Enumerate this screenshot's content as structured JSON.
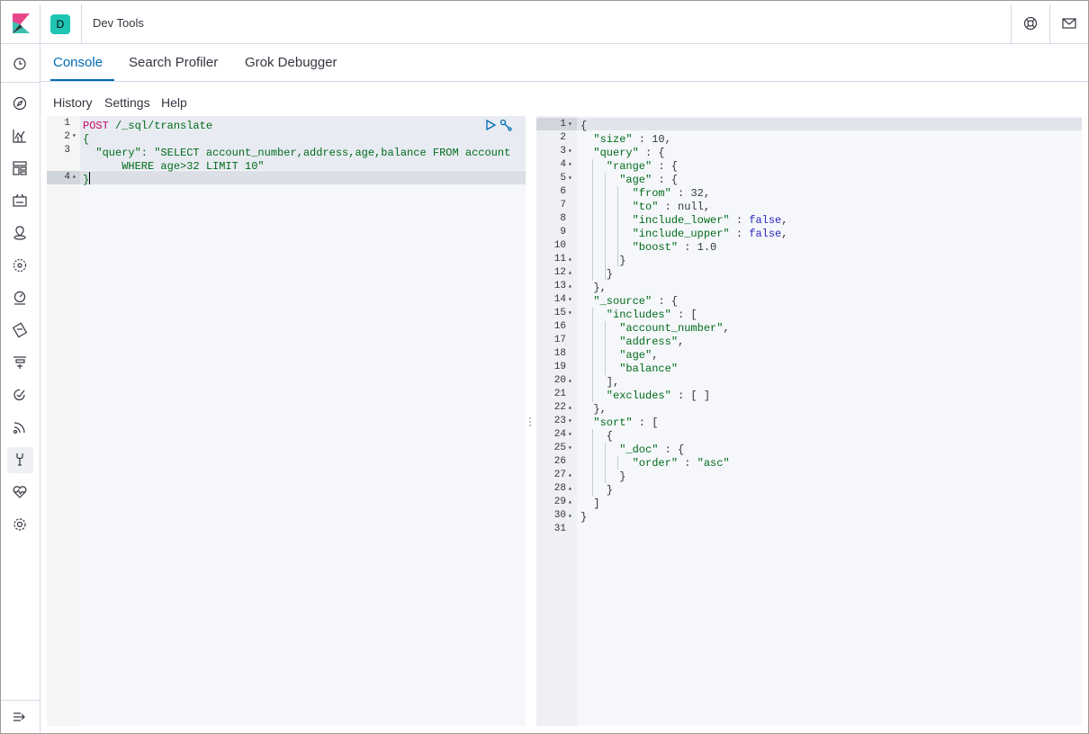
{
  "app": {
    "space_initial": "D",
    "title": "Dev Tools"
  },
  "tabs": [
    {
      "label": "Console",
      "active": true
    },
    {
      "label": "Search Profiler",
      "active": false
    },
    {
      "label": "Grok Debugger",
      "active": false
    }
  ],
  "menu": [
    "History",
    "Settings",
    "Help"
  ],
  "sidebar_icons": [
    "clock-icon",
    "compass-icon",
    "visualize-icon",
    "dashboard-icon",
    "canvas-icon",
    "maps-icon",
    "ml-icon",
    "metrics-icon",
    "logs-icon",
    "apm-icon",
    "uptime-icon",
    "siem-icon",
    "dev-tools-icon",
    "monitoring-icon",
    "management-icon",
    "collapse-icon"
  ],
  "colors": {
    "accent": "#006bb4",
    "space": "#1ec5b3",
    "keyword": "#c80a68",
    "string": "#006b1b",
    "literal": "#2927c2"
  },
  "request_editor": {
    "line_numbers": [
      "1",
      "2",
      "3",
      "",
      "4"
    ],
    "lines": [
      [
        {
          "t": "POST ",
          "c": "kw"
        },
        {
          "t": "/_sql/translate",
          "c": "str"
        }
      ],
      [
        {
          "t": "{",
          "c": "str"
        }
      ],
      [
        {
          "t": "  \"query\": \"SELECT account_number,address,age,balance FROM account",
          "c": "str"
        }
      ],
      [
        {
          "t": "      WHERE age>32 LIMIT 10\"",
          "c": "str"
        }
      ],
      [
        {
          "t": "}",
          "c": "str"
        }
      ]
    ]
  },
  "response_editor": {
    "lines": [
      {
        "n": "1",
        "fold": "▾",
        "seg": [
          {
            "t": "{",
            "c": "p"
          }
        ]
      },
      {
        "n": "2",
        "fold": "",
        "seg": [
          {
            "t": "  \"size\"",
            "c": "str"
          },
          {
            "t": " : ",
            "c": "p"
          },
          {
            "t": "10",
            "c": "num"
          },
          {
            "t": ",",
            "c": "p"
          }
        ]
      },
      {
        "n": "3",
        "fold": "▾",
        "seg": [
          {
            "t": "  \"query\"",
            "c": "str"
          },
          {
            "t": " : {",
            "c": "p"
          }
        ]
      },
      {
        "n": "4",
        "fold": "▾",
        "seg": [
          {
            "t": "    \"range\"",
            "c": "str"
          },
          {
            "t": " : {",
            "c": "p"
          }
        ]
      },
      {
        "n": "5",
        "fold": "▾",
        "seg": [
          {
            "t": "      \"age\"",
            "c": "str"
          },
          {
            "t": " : {",
            "c": "p"
          }
        ]
      },
      {
        "n": "6",
        "fold": "",
        "seg": [
          {
            "t": "        \"from\"",
            "c": "str"
          },
          {
            "t": " : ",
            "c": "p"
          },
          {
            "t": "32",
            "c": "num"
          },
          {
            "t": ",",
            "c": "p"
          }
        ]
      },
      {
        "n": "7",
        "fold": "",
        "seg": [
          {
            "t": "        \"to\"",
            "c": "str"
          },
          {
            "t": " : ",
            "c": "p"
          },
          {
            "t": "null",
            "c": "num"
          },
          {
            "t": ",",
            "c": "p"
          }
        ]
      },
      {
        "n": "8",
        "fold": "",
        "seg": [
          {
            "t": "        \"include_lower\"",
            "c": "str"
          },
          {
            "t": " : ",
            "c": "p"
          },
          {
            "t": "false",
            "c": "lit"
          },
          {
            "t": ",",
            "c": "p"
          }
        ]
      },
      {
        "n": "9",
        "fold": "",
        "seg": [
          {
            "t": "        \"include_upper\"",
            "c": "str"
          },
          {
            "t": " : ",
            "c": "p"
          },
          {
            "t": "false",
            "c": "lit"
          },
          {
            "t": ",",
            "c": "p"
          }
        ]
      },
      {
        "n": "10",
        "fold": "",
        "seg": [
          {
            "t": "        \"boost\"",
            "c": "str"
          },
          {
            "t": " : ",
            "c": "p"
          },
          {
            "t": "1.0",
            "c": "num"
          }
        ]
      },
      {
        "n": "11",
        "fold": "▴",
        "seg": [
          {
            "t": "      }",
            "c": "p"
          }
        ]
      },
      {
        "n": "12",
        "fold": "▴",
        "seg": [
          {
            "t": "    }",
            "c": "p"
          }
        ]
      },
      {
        "n": "13",
        "fold": "▴",
        "seg": [
          {
            "t": "  },",
            "c": "p"
          }
        ]
      },
      {
        "n": "14",
        "fold": "▾",
        "seg": [
          {
            "t": "  \"_source\"",
            "c": "str"
          },
          {
            "t": " : {",
            "c": "p"
          }
        ]
      },
      {
        "n": "15",
        "fold": "▾",
        "seg": [
          {
            "t": "    \"includes\"",
            "c": "str"
          },
          {
            "t": " : [",
            "c": "p"
          }
        ]
      },
      {
        "n": "16",
        "fold": "",
        "seg": [
          {
            "t": "      \"account_number\"",
            "c": "str"
          },
          {
            "t": ",",
            "c": "p"
          }
        ]
      },
      {
        "n": "17",
        "fold": "",
        "seg": [
          {
            "t": "      \"address\"",
            "c": "str"
          },
          {
            "t": ",",
            "c": "p"
          }
        ]
      },
      {
        "n": "18",
        "fold": "",
        "seg": [
          {
            "t": "      \"age\"",
            "c": "str"
          },
          {
            "t": ",",
            "c": "p"
          }
        ]
      },
      {
        "n": "19",
        "fold": "",
        "seg": [
          {
            "t": "      \"balance\"",
            "c": "str"
          }
        ]
      },
      {
        "n": "20",
        "fold": "▴",
        "seg": [
          {
            "t": "    ],",
            "c": "p"
          }
        ]
      },
      {
        "n": "21",
        "fold": "",
        "seg": [
          {
            "t": "    \"excludes\"",
            "c": "str"
          },
          {
            "t": " : [ ]",
            "c": "p"
          }
        ]
      },
      {
        "n": "22",
        "fold": "▴",
        "seg": [
          {
            "t": "  },",
            "c": "p"
          }
        ]
      },
      {
        "n": "23",
        "fold": "▾",
        "seg": [
          {
            "t": "  \"sort\"",
            "c": "str"
          },
          {
            "t": " : [",
            "c": "p"
          }
        ]
      },
      {
        "n": "24",
        "fold": "▾",
        "seg": [
          {
            "t": "    {",
            "c": "p"
          }
        ]
      },
      {
        "n": "25",
        "fold": "▾",
        "seg": [
          {
            "t": "      \"_doc\"",
            "c": "str"
          },
          {
            "t": " : {",
            "c": "p"
          }
        ]
      },
      {
        "n": "26",
        "fold": "",
        "seg": [
          {
            "t": "        \"order\"",
            "c": "str"
          },
          {
            "t": " : ",
            "c": "p"
          },
          {
            "t": "\"asc\"",
            "c": "str"
          }
        ]
      },
      {
        "n": "27",
        "fold": "▴",
        "seg": [
          {
            "t": "      }",
            "c": "p"
          }
        ]
      },
      {
        "n": "28",
        "fold": "▴",
        "seg": [
          {
            "t": "    }",
            "c": "p"
          }
        ]
      },
      {
        "n": "29",
        "fold": "▴",
        "seg": [
          {
            "t": "  ]",
            "c": "p"
          }
        ]
      },
      {
        "n": "30",
        "fold": "▴",
        "seg": [
          {
            "t": "}",
            "c": "p"
          }
        ]
      },
      {
        "n": "31",
        "fold": "",
        "seg": []
      }
    ]
  }
}
